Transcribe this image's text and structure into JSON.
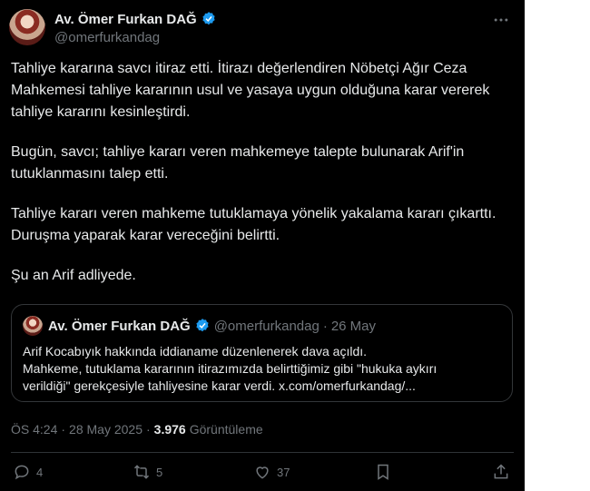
{
  "author": {
    "display_name": "Av. Ömer Furkan DAĞ",
    "handle": "@omerfurkandag"
  },
  "tweet": {
    "paragraphs": [
      "Tahliye kararına savcı itiraz etti. İtirazı değerlendiren Nöbetçi Ağır Ceza Mahkemesi tahliye kararının usul ve yasaya uygun olduğuna karar vererek tahliye kararını kesinleştirdi.",
      "Bugün, savcı; tahliye kararı veren mahkemeye talepte bulunarak Arif'in tutuklanmasını talep etti.",
      "Tahliye kararı veren mahkeme tutuklamaya yönelik yakalama kararı çıkarttı. Duruşma yaparak karar vereceğini belirtti.",
      "Şu an Arif adliyede."
    ]
  },
  "quote": {
    "display_name": "Av. Ömer Furkan DAĞ",
    "handle": "@omerfurkandag",
    "separator": "·",
    "date": "26 May",
    "lines": [
      "Arif Kocabıyık hakkında iddianame düzenlenerek dava açıldı.",
      "Mahkeme, tutuklama kararının itirazımızda belirttiğimiz gibi \"hukuka aykırı",
      "verildiği\" gerekçesiyle tahliyesine karar verdi. x.com/omerfurkandag/..."
    ]
  },
  "meta": {
    "time": "ÖS 4:24",
    "separator": "·",
    "date": "28 May 2025",
    "views_count": "3.976",
    "views_label": "Görüntüleme"
  },
  "actions": {
    "replies": "4",
    "reposts": "5",
    "likes": "37"
  },
  "colors": {
    "background": "#000000",
    "text": "#e7e9ea",
    "muted": "#71767b",
    "verified": "#1d9bf0",
    "border": "#333639"
  },
  "icons": [
    "verified-badge-icon",
    "more-icon",
    "reply-icon",
    "repost-icon",
    "like-icon",
    "bookmark-icon",
    "share-icon"
  ]
}
